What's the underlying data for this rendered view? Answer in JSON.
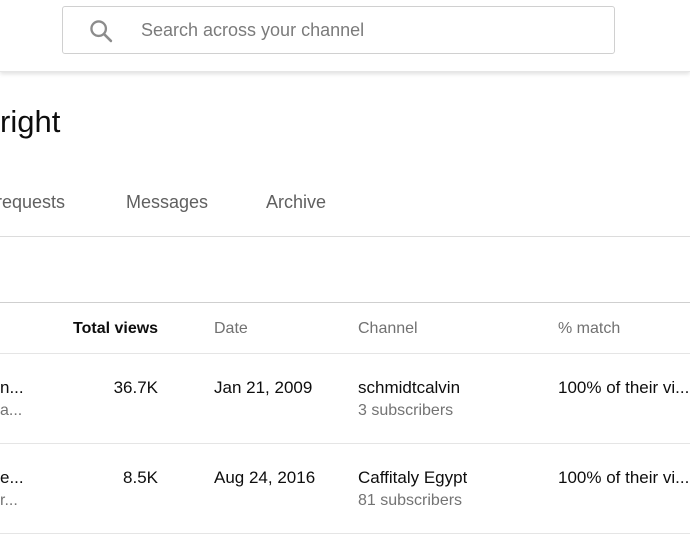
{
  "search": {
    "placeholder": "Search across your channel"
  },
  "page": {
    "title": "right"
  },
  "tabs": [
    {
      "label": "requests"
    },
    {
      "label": "Messages"
    },
    {
      "label": "Archive"
    }
  ],
  "table": {
    "headers": {
      "total_views": "Total views",
      "date": "Date",
      "channel": "Channel",
      "match": "% match"
    },
    "rows": [
      {
        "video_title": "n...",
        "video_sub": "a...",
        "total_views": "36.7K",
        "date": "Jan 21, 2009",
        "channel": "schmidtcalvin",
        "subscribers": "3 subscribers",
        "match": "100% of their vi..."
      },
      {
        "video_title": "e...",
        "video_sub": "r...",
        "total_views": "8.5K",
        "date": "Aug 24, 2016",
        "channel": "Caffitaly Egypt",
        "subscribers": "81 subscribers",
        "match": "100% of their vi..."
      }
    ]
  }
}
